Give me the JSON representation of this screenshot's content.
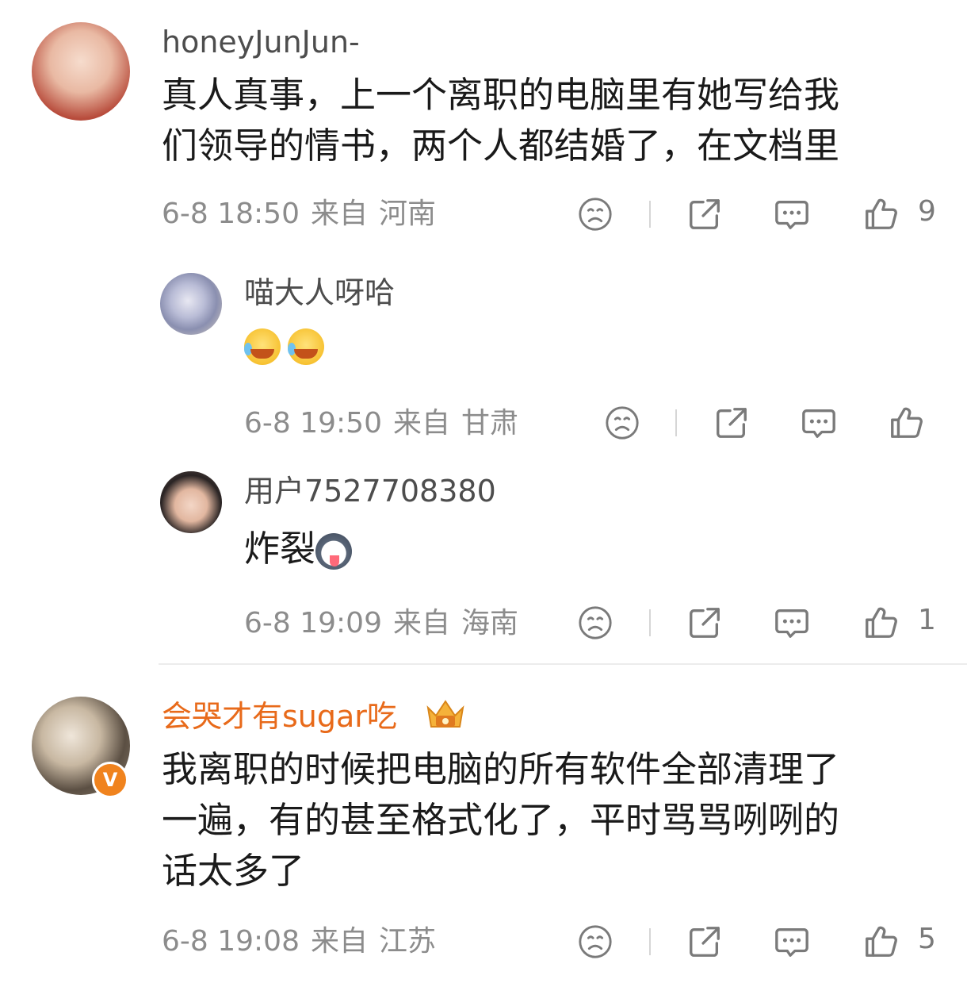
{
  "comments": [
    {
      "username": "honeyJunJun-",
      "text": "真人真事，上一个离职的电脑里有她写给我\n们领导的情书，两个人都结婚了，在文档里",
      "time": "6-8 18:50",
      "from": "来自",
      "location": "河南",
      "likes": "9"
    },
    {
      "username": "喵大人呀哈",
      "text": "",
      "time": "6-8 19:50",
      "from": "来自",
      "location": "甘肃",
      "likes": ""
    },
    {
      "username": "用户7527708380",
      "text": "炸裂",
      "time": "6-8 19:09",
      "from": "来自",
      "location": "海南",
      "likes": "1"
    },
    {
      "username": "会哭才有sugar吃",
      "text": "我离职的时候把电脑的所有软件全部清理了\n一遍，有的甚至格式化了，平时骂骂咧咧的\n话太多了",
      "time": "6-8 19:08",
      "from": "来自",
      "location": "江苏",
      "likes": "5",
      "verified_label": "V"
    }
  ],
  "icons": [
    "sad-face-icon",
    "share-icon",
    "comment-icon",
    "like-icon",
    "crown-badge-icon",
    "laugh-cry-emoji",
    "husky-emoji"
  ],
  "colors": {
    "vip_name": "#e86a1a",
    "meta": "#8c8c8c",
    "icon": "#7a7a7a"
  }
}
